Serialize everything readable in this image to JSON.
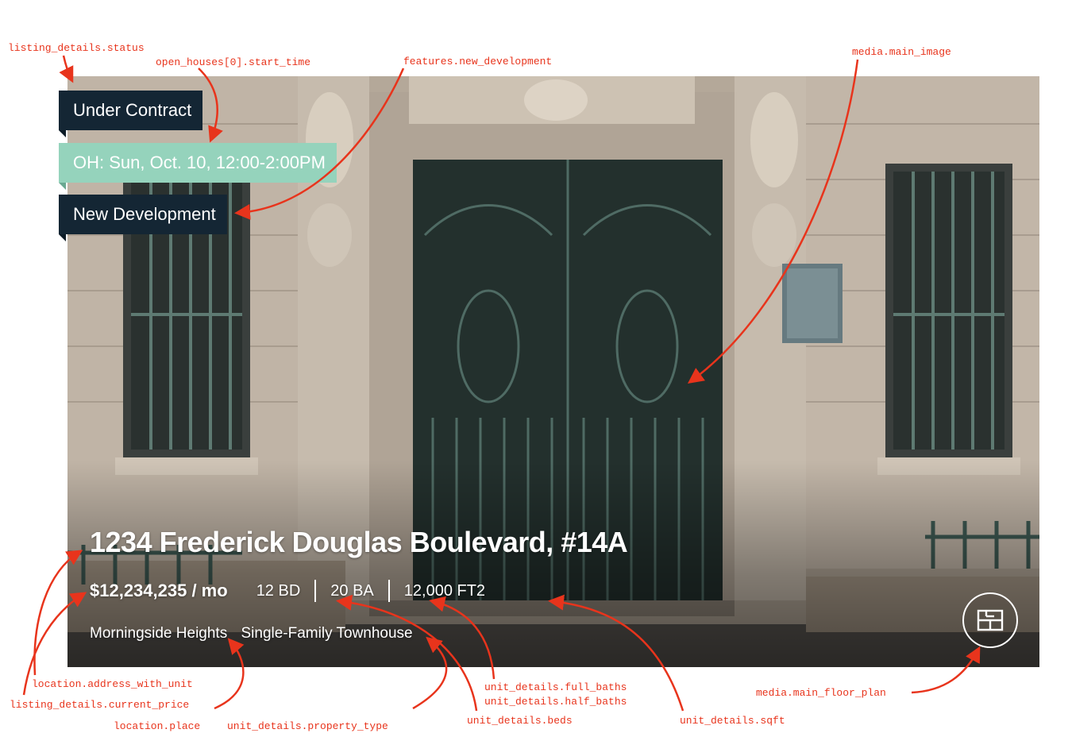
{
  "listing": {
    "status": "Under Contract",
    "open_house": "OH: Sun, Oct. 10, 12:00-2:00PM",
    "feature": "New Development",
    "address": "1234 Frederick Douglas Boulevard, #14A",
    "price": "$12,234,235 / mo",
    "beds": "12 BD",
    "baths": "20 BA",
    "sqft": "12,000 FT2",
    "place": "Morningside Heights",
    "property_type": "Single-Family Townhouse",
    "floor_plan_icon": "floor-plan-icon"
  },
  "annotations": {
    "status": "listing_details.status",
    "open_house": "open_houses[0].start_time",
    "new_development": "features.new_development",
    "main_image": "media.main_image",
    "address": "location.address_with_unit",
    "price": "listing_details.current_price",
    "place": "location.place",
    "property_type": "unit_details.property_type",
    "full_baths": "unit_details.full_baths",
    "half_baths": "unit_details.half_baths",
    "beds": "unit_details.beds",
    "sqft": "unit_details.sqft",
    "floor_plan": "media.main_floor_plan"
  },
  "colors": {
    "annotation": "#e8341c",
    "tag_dark": "#142634",
    "tag_open_house": "#95d3bc"
  }
}
